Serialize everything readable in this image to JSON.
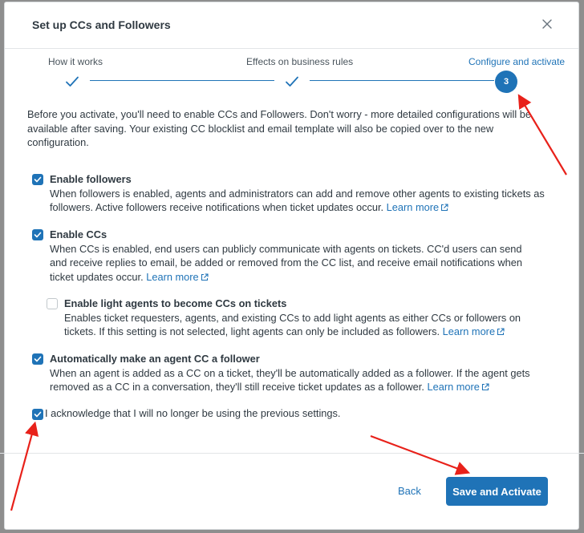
{
  "dialog": {
    "title": "Set up CCs and Followers",
    "close_icon": "close-icon"
  },
  "stepper": {
    "steps": [
      {
        "label": "How it works",
        "state": "complete",
        "icon": "check-icon"
      },
      {
        "label": "Effects on business rules",
        "state": "complete",
        "icon": "check-icon"
      },
      {
        "label": "Configure and activate",
        "state": "current",
        "number": "3"
      }
    ]
  },
  "intro": "Before you activate, you'll need to enable CCs and Followers. Don't worry - more detailed configurations will be available after saving. Your existing CC blocklist and email template will also be copied over to the new configuration.",
  "options": [
    {
      "title": "Enable followers",
      "checked": true,
      "description": "When followers is enabled, agents and administrators can add and remove other agents to existing tickets as followers. Active followers receive notifications when ticket updates occur.",
      "link": "Learn more"
    },
    {
      "title": "Enable CCs",
      "checked": true,
      "description": "When CCs is enabled, end users can publicly communicate with agents on tickets. CC'd users can send and receive replies to email, be added or removed from the CC list, and receive email notifications when ticket updates occur.",
      "link": "Learn more"
    },
    {
      "title": "Enable light agents to become CCs on tickets",
      "checked": false,
      "description": "Enables ticket requesters, agents, and existing CCs to add light agents as either CCs or followers on tickets. If this setting is not selected, light agents can only be included as followers.",
      "link": "Learn more"
    },
    {
      "title": "Automatically make an agent CC a follower",
      "checked": true,
      "description": "When an agent is added as a CC on a ticket, they'll be automatically added as a follower. If the agent gets removed as a CC in a conversation, they'll still receive ticket updates as a follower.",
      "link": "Learn more"
    }
  ],
  "acknowledge": {
    "label": "I acknowledge that I will no longer be using the previous settings.",
    "checked": true
  },
  "footer": {
    "back_label": "Back",
    "primary_label": "Save and Activate"
  },
  "colors": {
    "accent": "#1f73b7",
    "annotation_arrow": "#e8211a"
  }
}
